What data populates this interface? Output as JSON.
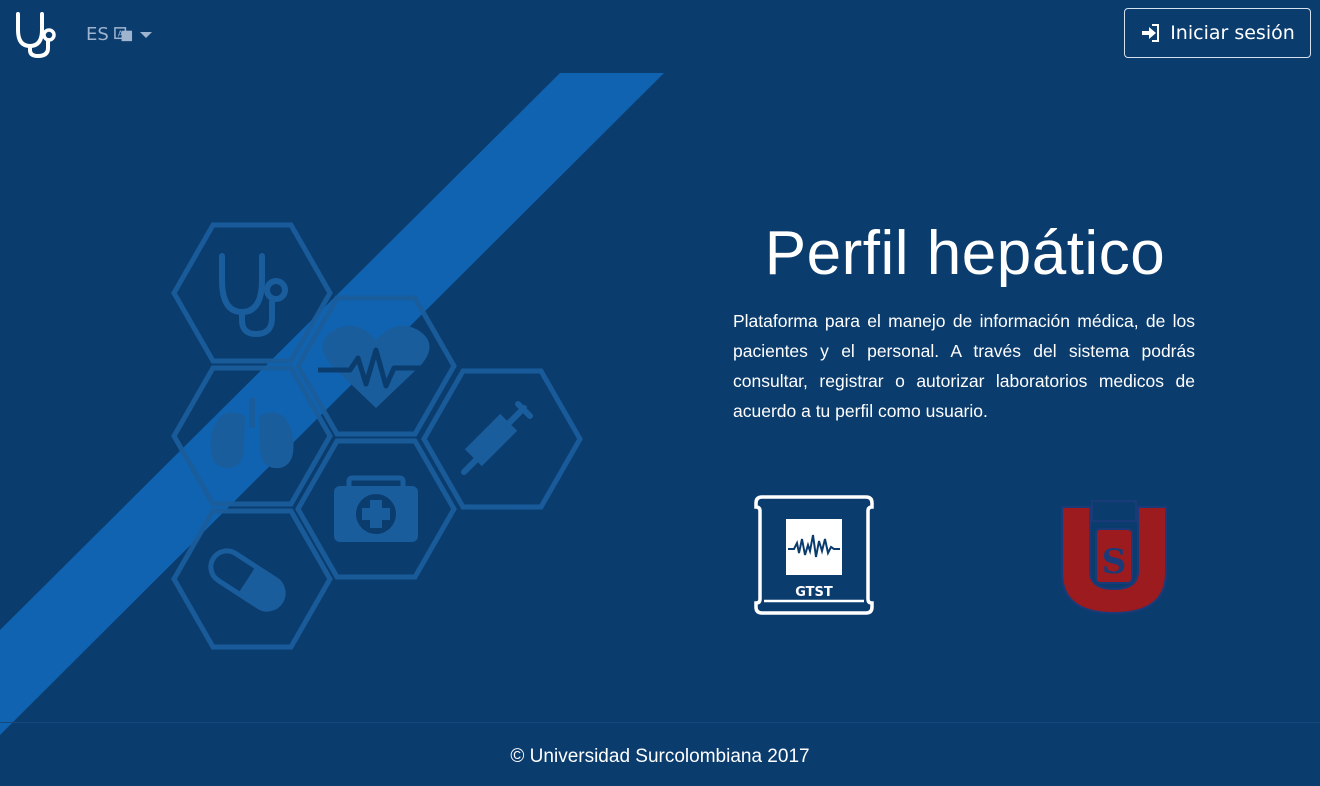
{
  "header": {
    "language": {
      "code": "ES",
      "icon": "translate-icon"
    },
    "login": {
      "label": "Iniciar sesión",
      "icon": "sign-in-icon"
    },
    "brand_icon": "stethoscope-icon"
  },
  "hero": {
    "title": "Perfil hepático",
    "description": "Plataforma para el manejo de información médica, de los pacientes y el personal. A través del sistema podrás consultar, registrar o autorizar laboratorios medicos de acuerdo a tu perfil como usuario."
  },
  "partner_logos": [
    {
      "name": "GTST",
      "label": "GTST"
    },
    {
      "name": "Universidad Surcolombiana",
      "label": "S"
    }
  ],
  "medical_icons": [
    "stethoscope-icon",
    "heartbeat-icon",
    "lungs-icon",
    "syringe-icon",
    "first-aid-kit-icon",
    "pill-icon"
  ],
  "footer": {
    "copyright": "© Universidad Surcolombiana 2017"
  },
  "colors": {
    "background": "#0b3c6e",
    "stripe": "#1063b1",
    "hex_outline": "#1a5d9c",
    "usco_red": "#9b1b1f",
    "usco_blue": "#1b3a78"
  }
}
